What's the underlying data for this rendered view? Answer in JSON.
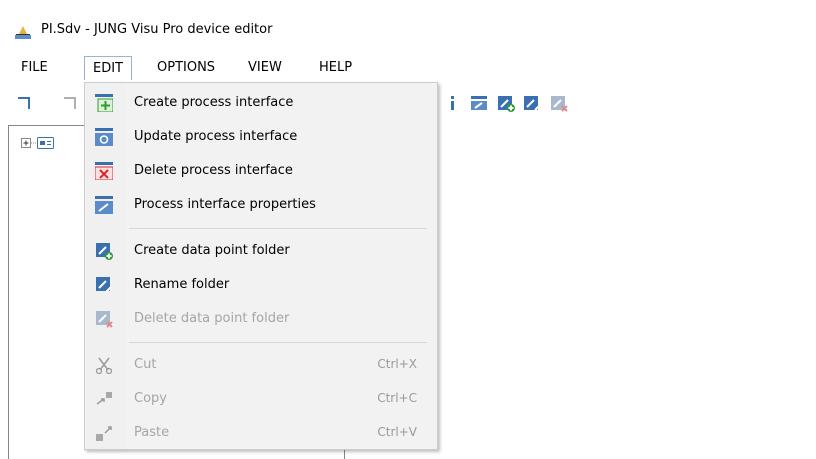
{
  "window": {
    "title": "PI.Sdv - JUNG Visu Pro device editor"
  },
  "menubar": {
    "items": [
      "FILE",
      "EDIT",
      "OPTIONS",
      "VIEW",
      "HELP"
    ]
  },
  "edit_menu": {
    "create_pi": {
      "label": "Create process interface",
      "icon": "create-process-interface-icon"
    },
    "update_pi": {
      "label": "Update process interface",
      "icon": "update-process-interface-icon"
    },
    "delete_pi": {
      "label": "Delete process interface",
      "icon": "delete-process-interface-icon"
    },
    "pi_props": {
      "label": "Process interface properties",
      "icon": "process-interface-properties-icon"
    },
    "create_folder": {
      "label": "Create data point folder",
      "icon": "create-folder-icon"
    },
    "rename_folder": {
      "label": "Rename folder",
      "icon": "rename-folder-icon"
    },
    "delete_folder": {
      "label": "Delete data point folder",
      "icon": "delete-folder-icon",
      "disabled": true
    },
    "cut": {
      "label": "Cut",
      "shortcut": "Ctrl+X",
      "icon": "scissors-icon",
      "disabled": true
    },
    "copy": {
      "label": "Copy",
      "shortcut": "Ctrl+C",
      "icon": "copy-icon",
      "disabled": true
    },
    "paste": {
      "label": "Paste",
      "shortcut": "Ctrl+V",
      "icon": "paste-icon",
      "disabled": true
    }
  },
  "colors": {
    "accent_blue": "#3a6fb0",
    "green_plus": "#2e9e2e",
    "red_x": "#d9262c",
    "disabled": "#a5a5a5",
    "menu_bg": "#f2f2f2"
  }
}
